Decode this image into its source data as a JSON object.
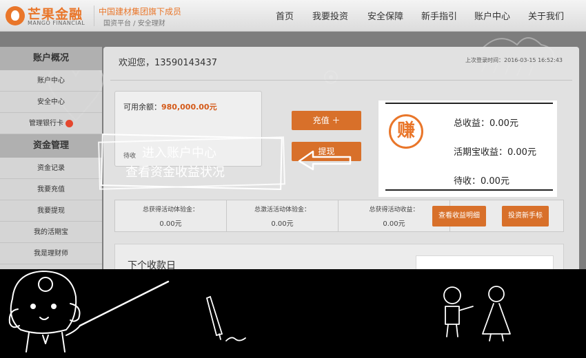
{
  "header": {
    "logo_cn": "芒果金融",
    "logo_en": "MANGO FINANCIAL",
    "tagline": "中国建材集团旗下成员",
    "tagline_sub": "国资平台 / 安全理财",
    "nav": [
      "首页",
      "我要投资",
      "安全保障",
      "新手指引",
      "账户中心",
      "关于我们"
    ]
  },
  "sidebar": {
    "sections": [
      {
        "title": "账户概况",
        "items": [
          "账户中心",
          "安全中心",
          "管理银行卡"
        ]
      },
      {
        "title": "资金管理",
        "items": [
          "资金记录",
          "我要充值",
          "我要提现",
          "我的活期宝",
          "我是理财师"
        ]
      }
    ]
  },
  "main": {
    "welcome": "欢迎您，13590143437",
    "last_login": "上次登录时间：2016-03-15 16:52:43",
    "balance_label": "可用余额：",
    "balance_value": "980,000.00元",
    "pending_label": "待收",
    "recharge_button": "充值 ＋",
    "withdraw_button": "提现",
    "stats": [
      {
        "label": "总获得活动体验金：",
        "value": "0.00元"
      },
      {
        "label": "总激活活动体验金：",
        "value": "0.00元"
      },
      {
        "label": "总获得活动收益：",
        "value": "0.00元"
      }
    ],
    "view_earnings_button": "查看收益明细",
    "invest_novice_button": "投资新手标",
    "next_title": "下个收款日"
  },
  "callout": {
    "icon_char": "赚",
    "total_earnings": "总收益：0.00元",
    "current_earnings": "活期宝收益：0.00元",
    "pending_earnings": "待收：0.00元"
  },
  "annotation": {
    "line1": "进入账户中心",
    "line2": "查看资金收益状况"
  },
  "colors": {
    "accent": "#e9762a",
    "button": "#d8702a",
    "backdrop": "#7d7d7d",
    "band": "#000000"
  },
  "icons": [
    "mango-logo-icon",
    "red-envelope-icon",
    "zhuan-earn-icon",
    "arrow-left-icon",
    "mascot-icon",
    "pencil-icon",
    "couple-figures-icon"
  ]
}
